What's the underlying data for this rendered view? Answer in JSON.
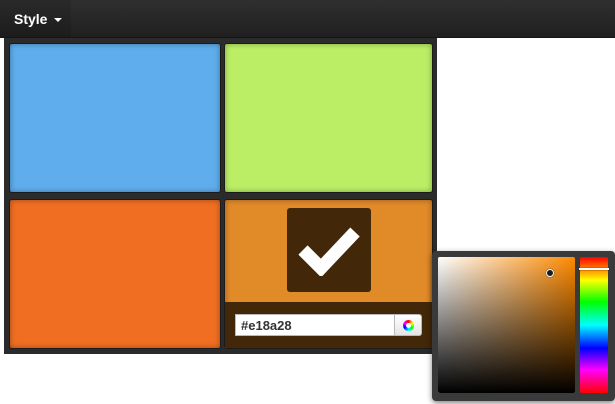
{
  "menu": {
    "style_label": "Style"
  },
  "tiles": [
    {
      "color": "#5fadec",
      "selected": false
    },
    {
      "color": "#bbee64",
      "selected": false
    },
    {
      "color": "#f06e22",
      "selected": false
    },
    {
      "color": "#e18a28",
      "selected": true
    }
  ],
  "selected_tile": {
    "check_icon": "checkmark-icon",
    "hex_value": "#e18a28",
    "picker_button_icon": "color-wheel-icon"
  },
  "picker": {
    "hue_color": "#ff8a00",
    "saturation": 0.82,
    "value": 0.88,
    "hue_fraction": 0.085
  }
}
